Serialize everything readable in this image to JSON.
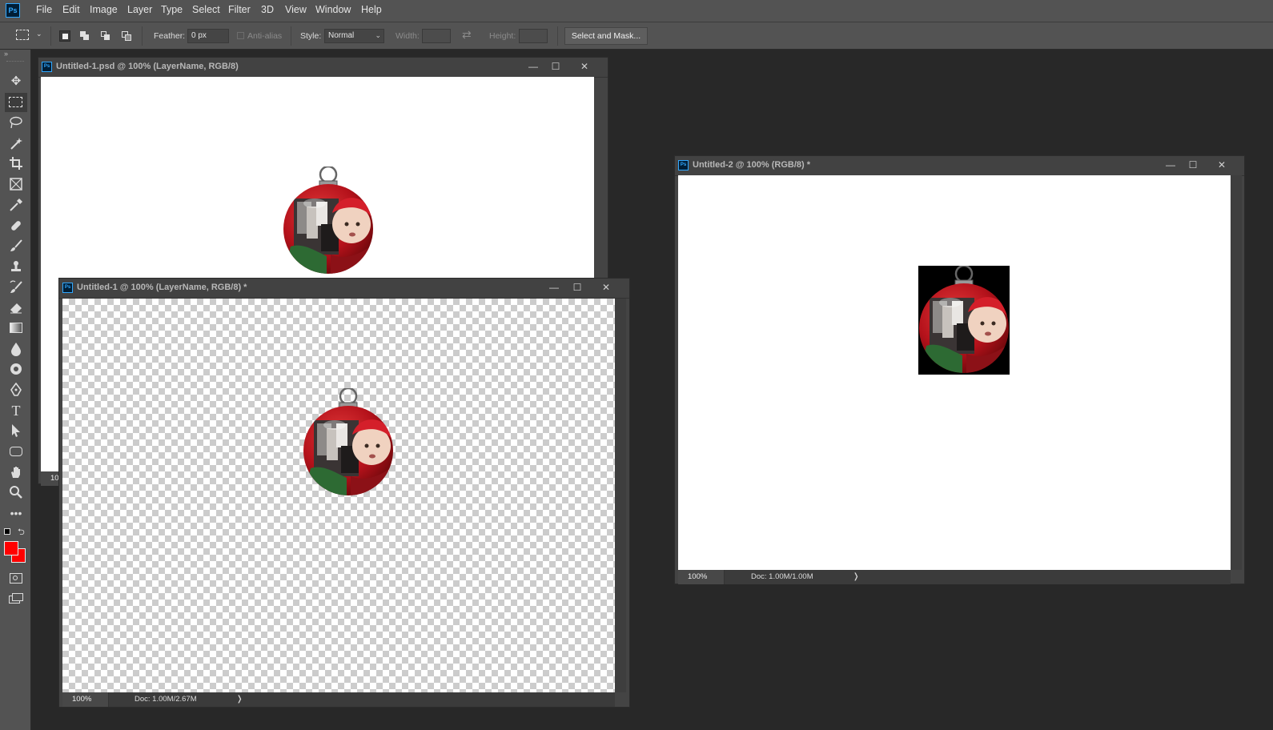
{
  "app": {
    "logo_text": "Ps"
  },
  "menu": [
    "File",
    "Edit",
    "Image",
    "Layer",
    "Type",
    "Select",
    "Filter",
    "3D",
    "View",
    "Window",
    "Help"
  ],
  "options_bar": {
    "feather_label": "Feather:",
    "feather_value": "0 px",
    "antialias_label": "Anti-alias",
    "style_label": "Style:",
    "style_value": "Normal",
    "width_label": "Width:",
    "height_label": "Height:",
    "select_mask_label": "Select and Mask..."
  },
  "colors": {
    "foreground": "#ff0000",
    "background": "#ff0000"
  },
  "tools": [
    "move-icon",
    "marquee-icon",
    "lasso-icon",
    "magic-wand-icon",
    "crop-icon",
    "frame-icon",
    "eyedropper-icon",
    "healing-brush-icon",
    "brush-icon",
    "stamp-icon",
    "history-brush-icon",
    "eraser-icon",
    "gradient-icon",
    "blur-icon",
    "dodge-icon",
    "pen-icon",
    "type-icon",
    "path-select-icon",
    "shape-icon",
    "hand-icon",
    "zoom-icon",
    "more-tools-icon",
    "quick-mask-icon",
    "screen-mode-icon"
  ],
  "documents": {
    "doc1": {
      "title": "Untitled-1.psd @ 100% (LayerName, RGB/8)",
      "zoom": "10"
    },
    "doc2": {
      "title": "Untitled-1 @ 100% (LayerName, RGB/8) *",
      "zoom": "100%",
      "doc_info": "Doc: 1.00M/2.67M"
    },
    "doc3": {
      "title": "Untitled-2 @ 100% (RGB/8) *",
      "zoom": "100%",
      "doc_info": "Doc: 1.00M/1.00M"
    }
  },
  "window_controls": {
    "minimize": "—",
    "maximize": "☐",
    "close": "✕"
  },
  "status_arrow": "❭"
}
